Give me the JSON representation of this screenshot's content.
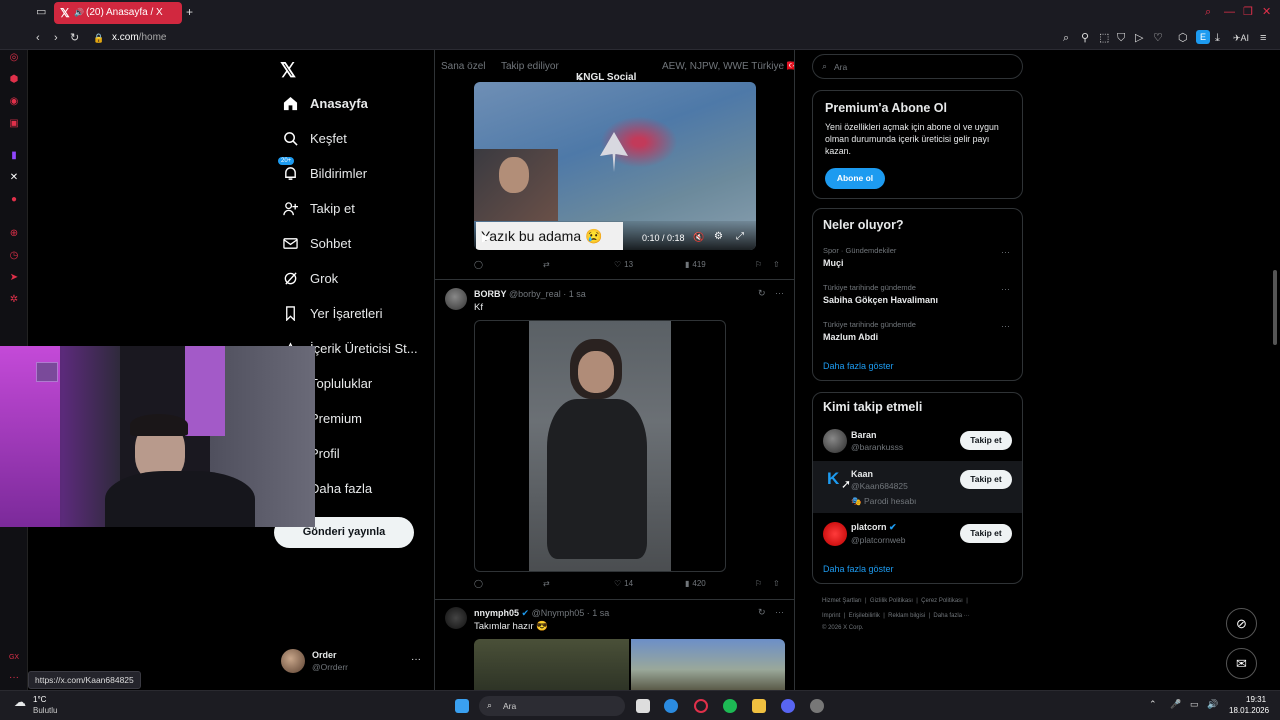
{
  "browser": {
    "tab_title": "(20) Anasayfa / X",
    "url_host": "x.com",
    "url_path": "/home",
    "status_url": "https://x.com/Kaan684825"
  },
  "nav": {
    "home": "Anasayfa",
    "explore": "Keşfet",
    "notifications": "Bildirimler",
    "notifications_badge": "20+",
    "follow": "Takip et",
    "chat": "Sohbet",
    "grok": "Grok",
    "bookmarks": "Yer İşaretleri",
    "creator_studio": "İçerik Üreticisi St...",
    "communities": "Topluluklar",
    "premium": "Premium",
    "profile": "Profil",
    "more": "Daha fazla",
    "post_button": "Gönderi yayınla",
    "account_name": "Order",
    "account_handle": "@Orrderr"
  },
  "feed_tabs": [
    "Sana özel",
    "Takip ediliyor",
    "KNGL Social",
    "AEW, NJPW, WWE Türkiye 🇹🇷"
  ],
  "tweet1": {
    "caption": "Yazık bu adama 😢",
    "time": "0:10 / 0:18",
    "retweets": "",
    "likes": "13",
    "views": "419"
  },
  "tweet2": {
    "name": "BORBY",
    "handle": "@borby_real",
    "time": "1 sa",
    "text": "Kf",
    "likes": "14",
    "views": "420"
  },
  "tweet3": {
    "name": "nnymph05",
    "handle": "@Nnymph05",
    "time": "1 sa",
    "text": "Takımlar hazır 😎"
  },
  "search": {
    "placeholder": "Ara"
  },
  "premium_card": {
    "title": "Premium'a Abone Ol",
    "body": "Yeni özellikleri açmak için abone ol ve uygun olman durumunda içerik üreticisi gelir payı kazan.",
    "button": "Abone ol"
  },
  "trends": {
    "title": "Neler oluyor?",
    "items": [
      {
        "meta": "Spor · Gündemdekiler",
        "name": "Muçi"
      },
      {
        "meta": "Türkiye tarihinde gündemde",
        "name": "Sabiha Gökçen Havalimanı"
      },
      {
        "meta": "Türkiye tarihinde gündemde",
        "name": "Mazlum Abdi"
      }
    ],
    "show_more": "Daha fazla göster"
  },
  "who_to_follow": {
    "title": "Kimi takip etmeli",
    "items": [
      {
        "name": "Baran",
        "handle": "@barankusss",
        "note": "",
        "button": "Takip et"
      },
      {
        "name": "Kaan",
        "handle": "@Kaan684825",
        "note": "Parodi hesabı",
        "button": "Takip et"
      },
      {
        "name": "platcorn",
        "handle": "@platcornweb",
        "note": "",
        "button": "Takip et"
      }
    ],
    "show_more": "Daha fazla göster"
  },
  "footer": {
    "links": [
      "Hizmet Şartları",
      "Gizlilik Politikası",
      "Çerez Politikası",
      "Imprint",
      "Erişilebilirlik",
      "Reklam bilgisi",
      "Daha fazla ···"
    ],
    "copyright": "© 2026 X Corp."
  },
  "taskbar": {
    "weather_temp": "1°C",
    "weather_desc": "Bulutlu",
    "search": "Ara",
    "time": "19:31",
    "date": "18.01.2026"
  },
  "colors": {
    "accent": "#1d9bf0",
    "opera_red": "#d1283f",
    "bg": "#000000"
  }
}
